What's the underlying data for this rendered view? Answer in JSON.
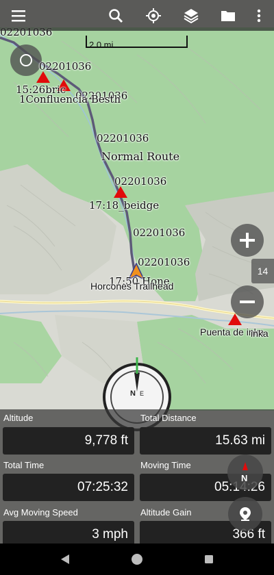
{
  "colors": {
    "accent_red": "#e10b0b",
    "route": "#5d5a78",
    "forest": "#9bd096",
    "stats_bg": "#3a3a3a"
  },
  "topbar": {
    "icons": [
      "menu-icon",
      "search-icon",
      "gps-location-icon",
      "layers-icon",
      "folder-icon",
      "more-vert-icon"
    ]
  },
  "map": {
    "scale_label": "2.0 mi",
    "zoom_level": "14",
    "labels": {
      "wp_top_left": "02201036",
      "wp_1": "02201036",
      "wp_2": "02201036",
      "wp_3": "02201036",
      "wp_4": "02201036",
      "wp_5": "02201036",
      "wp_6": "02201036",
      "time_1526": "15:26bric",
      "confluencia": "1Confluencia Besth",
      "normal_route": "Normal Route",
      "beidge": "17:18_beidge",
      "time_1750": "17:50 Hone",
      "horcones": "Horcones Trailhead",
      "puente": "Puenta de inka",
      "inka": "inka"
    }
  },
  "stats": {
    "altitude": {
      "label": "Altitude",
      "value": "9,778 ft"
    },
    "total_distance": {
      "label": "Total Distance",
      "value": "15.63 mi"
    },
    "total_time": {
      "label": "Total Time",
      "value": "07:25:32"
    },
    "moving_time": {
      "label": "Moving Time",
      "value": "05:14:26"
    },
    "avg_speed": {
      "label": "Avg Moving Speed",
      "value": "3 mph"
    },
    "altitude_gain": {
      "label": "Altitude Gain",
      "value": "366 ft"
    }
  },
  "compass": {
    "north_label": "N"
  },
  "navbar": {
    "icons": [
      "back-icon",
      "home-icon",
      "recents-icon"
    ]
  }
}
